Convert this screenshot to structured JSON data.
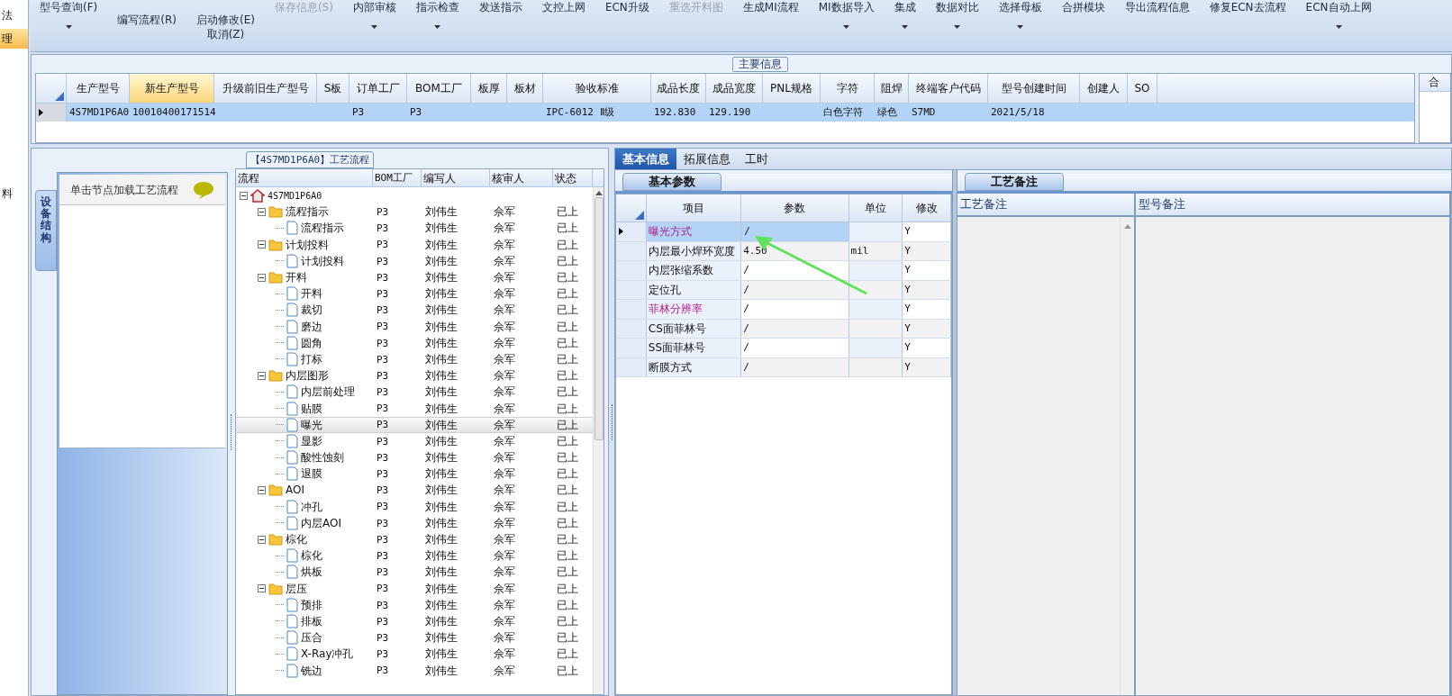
{
  "sidebar": {
    "items": [
      {
        "label": "法",
        "selected": false
      },
      {
        "label": "理",
        "selected": true
      },
      {
        "label": "料",
        "selected": false
      }
    ]
  },
  "toolbar": {
    "buttons": [
      {
        "kind": "top",
        "labels": [
          "型号查询(F)"
        ],
        "disabled": false,
        "dropdown": true
      },
      {
        "kind": "mid",
        "labels": [
          "编写流程(R)"
        ],
        "disabled": false,
        "dropdown": false
      },
      {
        "kind": "mid",
        "labels": [
          "启动修改(E)",
          "取消(Z)"
        ],
        "disabled": false,
        "dropdown": false
      },
      {
        "kind": "top",
        "labels": [
          "保存信息(S)"
        ],
        "disabled": true,
        "dropdown": false
      },
      {
        "kind": "top",
        "labels": [
          "内部审核"
        ],
        "disabled": false,
        "dropdown": true
      },
      {
        "kind": "top",
        "labels": [
          "指示检查"
        ],
        "disabled": false,
        "dropdown": true
      },
      {
        "kind": "top",
        "labels": [
          "发送指示"
        ],
        "disabled": false,
        "dropdown": false
      },
      {
        "kind": "top",
        "labels": [
          "文控上网"
        ],
        "disabled": false,
        "dropdown": false
      },
      {
        "kind": "top",
        "labels": [
          "ECN升级"
        ],
        "disabled": false,
        "dropdown": false
      },
      {
        "kind": "top",
        "labels": [
          "重选开料图"
        ],
        "disabled": true,
        "dropdown": false
      },
      {
        "kind": "top",
        "labels": [
          "生成MI流程"
        ],
        "disabled": false,
        "dropdown": false
      },
      {
        "kind": "top",
        "labels": [
          "MI数据导入"
        ],
        "disabled": false,
        "dropdown": true
      },
      {
        "kind": "top",
        "labels": [
          "集成"
        ],
        "disabled": false,
        "dropdown": true
      },
      {
        "kind": "top",
        "labels": [
          "数据对比"
        ],
        "disabled": false,
        "dropdown": true
      },
      {
        "kind": "top",
        "labels": [
          "选择母板"
        ],
        "disabled": false,
        "dropdown": true
      },
      {
        "kind": "top",
        "labels": [
          "合拼模块"
        ],
        "disabled": false,
        "dropdown": false
      },
      {
        "kind": "top",
        "labels": [
          "导出流程信息"
        ],
        "disabled": false,
        "dropdown": false
      },
      {
        "kind": "top",
        "labels": [
          "修复ECN去流程"
        ],
        "disabled": false,
        "dropdown": false
      },
      {
        "kind": "top",
        "labels": [
          "ECN自动上网"
        ],
        "disabled": false,
        "dropdown": true
      }
    ]
  },
  "main_info": {
    "title": "主要信息",
    "columns": [
      {
        "label": "生产型号",
        "selected": false
      },
      {
        "label": "新生产型号",
        "selected": true
      },
      {
        "label": "升级前旧生产型号",
        "selected": false
      },
      {
        "label": "S板",
        "selected": false
      },
      {
        "label": "订单工厂",
        "selected": false
      },
      {
        "label": "BOM工厂",
        "selected": false
      },
      {
        "label": "板厚",
        "selected": false
      },
      {
        "label": "板材",
        "selected": false
      },
      {
        "label": "验收标准",
        "selected": false
      },
      {
        "label": "成品长度",
        "selected": false
      },
      {
        "label": "成品宽度",
        "selected": false
      },
      {
        "label": "PNL规格",
        "selected": false
      },
      {
        "label": "字符",
        "selected": false
      },
      {
        "label": "阻焊",
        "selected": false
      },
      {
        "label": "终端客户代码",
        "selected": false
      },
      {
        "label": "型号创建时间",
        "selected": false
      },
      {
        "label": "创建人",
        "selected": false
      },
      {
        "label": "SO",
        "selected": false
      }
    ],
    "rows": [
      {
        "selected": true,
        "cells": [
          "4S7MD1P6A0",
          "10010400171514",
          "",
          "",
          "P3",
          "P3",
          "",
          "",
          "IPC-6012 Ⅱ级",
          "192.830",
          "129.190",
          "",
          "白色字符",
          "绿色",
          "S7MD",
          "2021/5/18",
          "",
          ""
        ]
      }
    ],
    "side_panel_header": "合"
  },
  "left_panel": {
    "tab": "设备结构",
    "hint": "单击节点加载工艺流程"
  },
  "process_flow": {
    "title": "【4S7MD1P6A0】工艺流程",
    "columns": [
      "流程",
      "BOM工厂",
      "编写人",
      "核审人",
      "状态"
    ],
    "tree": [
      {
        "label": "4S7MD1P6A0",
        "kind": "root",
        "expanded": true,
        "selected": false,
        "children": [
          {
            "label": "流程指示",
            "kind": "folder",
            "expanded": true,
            "selected": false,
            "values": [
              "P3",
              "刘伟生",
              "佘军",
              "已上"
            ],
            "children": [
              {
                "label": "流程指示",
                "kind": "step",
                "selected": false,
                "values": [
                  "P3",
                  "刘伟生",
                  "佘军",
                  "已上"
                ]
              }
            ]
          },
          {
            "label": "计划投料",
            "kind": "folder",
            "expanded": true,
            "selected": false,
            "values": [
              "P3",
              "刘伟生",
              "佘军",
              "已上"
            ],
            "children": [
              {
                "label": "计划投料",
                "kind": "step",
                "selected": false,
                "values": [
                  "P3",
                  "刘伟生",
                  "佘军",
                  "已上"
                ]
              }
            ]
          },
          {
            "label": "开料",
            "kind": "folder",
            "expanded": true,
            "selected": false,
            "values": [
              "P3",
              "刘伟生",
              "佘军",
              "已上"
            ],
            "children": [
              {
                "label": "开料",
                "kind": "step",
                "selected": false,
                "values": [
                  "P3",
                  "刘伟生",
                  "佘军",
                  "已上"
                ]
              },
              {
                "label": "裁切",
                "kind": "step",
                "selected": false,
                "values": [
                  "P3",
                  "刘伟生",
                  "佘军",
                  "已上"
                ]
              },
              {
                "label": "磨边",
                "kind": "step",
                "selected": false,
                "values": [
                  "P3",
                  "刘伟生",
                  "佘军",
                  "已上"
                ]
              },
              {
                "label": "圆角",
                "kind": "step",
                "selected": false,
                "values": [
                  "P3",
                  "刘伟生",
                  "佘军",
                  "已上"
                ]
              },
              {
                "label": "打标",
                "kind": "step",
                "selected": false,
                "values": [
                  "P3",
                  "刘伟生",
                  "佘军",
                  "已上"
                ]
              }
            ]
          },
          {
            "label": "内层图形",
            "kind": "folder",
            "expanded": true,
            "selected": false,
            "values": [
              "P3",
              "刘伟生",
              "佘军",
              "已上"
            ],
            "children": [
              {
                "label": "内层前处理",
                "kind": "step",
                "selected": false,
                "values": [
                  "P3",
                  "刘伟生",
                  "佘军",
                  "已上"
                ]
              },
              {
                "label": "贴膜",
                "kind": "step",
                "selected": false,
                "values": [
                  "P3",
                  "刘伟生",
                  "佘军",
                  "已上"
                ]
              },
              {
                "label": "曝光",
                "kind": "step",
                "selected": true,
                "values": [
                  "P3",
                  "刘伟生",
                  "佘军",
                  "已上"
                ]
              },
              {
                "label": "显影",
                "kind": "step",
                "selected": false,
                "values": [
                  "P3",
                  "刘伟生",
                  "佘军",
                  "已上"
                ]
              },
              {
                "label": "酸性蚀刻",
                "kind": "step",
                "selected": false,
                "values": [
                  "P3",
                  "刘伟生",
                  "佘军",
                  "已上"
                ]
              },
              {
                "label": "退膜",
                "kind": "step",
                "selected": false,
                "values": [
                  "P3",
                  "刘伟生",
                  "佘军",
                  "已上"
                ]
              }
            ]
          },
          {
            "label": "AOI",
            "kind": "folder",
            "expanded": true,
            "selected": false,
            "values": [
              "P3",
              "刘伟生",
              "佘军",
              "已上"
            ],
            "children": [
              {
                "label": "冲孔",
                "kind": "step",
                "selected": false,
                "values": [
                  "P3",
                  "刘伟生",
                  "佘军",
                  "已上"
                ]
              },
              {
                "label": "内层AOI",
                "kind": "step",
                "selected": false,
                "values": [
                  "P3",
                  "刘伟生",
                  "佘军",
                  "已上"
                ]
              }
            ]
          },
          {
            "label": "棕化",
            "kind": "folder",
            "expanded": true,
            "selected": false,
            "values": [
              "P3",
              "刘伟生",
              "佘军",
              "已上"
            ],
            "children": [
              {
                "label": "棕化",
                "kind": "step",
                "selected": false,
                "values": [
                  "P3",
                  "刘伟生",
                  "佘军",
                  "已上"
                ]
              },
              {
                "label": "烘板",
                "kind": "step",
                "selected": false,
                "values": [
                  "P3",
                  "刘伟生",
                  "佘军",
                  "已上"
                ]
              }
            ]
          },
          {
            "label": "层压",
            "kind": "folder",
            "expanded": true,
            "selected": false,
            "values": [
              "P3",
              "刘伟生",
              "佘军",
              "已上"
            ],
            "children": [
              {
                "label": "预排",
                "kind": "step",
                "selected": false,
                "values": [
                  "P3",
                  "刘伟生",
                  "佘军",
                  "已上"
                ]
              },
              {
                "label": "排板",
                "kind": "step",
                "selected": false,
                "values": [
                  "P3",
                  "刘伟生",
                  "佘军",
                  "已上"
                ]
              },
              {
                "label": "压合",
                "kind": "step",
                "selected": false,
                "values": [
                  "P3",
                  "刘伟生",
                  "佘军",
                  "已上"
                ]
              },
              {
                "label": "X-Ray冲孔",
                "kind": "step",
                "selected": false,
                "values": [
                  "P3",
                  "刘伟生",
                  "佘军",
                  "已上"
                ]
              },
              {
                "label": "铣边",
                "kind": "step",
                "selected": false,
                "values": [
                  "P3",
                  "刘伟生",
                  "佘军",
                  "已上"
                ]
              }
            ]
          }
        ]
      }
    ]
  },
  "detail_tabs": [
    {
      "label": "基本信息",
      "selected": true
    },
    {
      "label": "拓展信息",
      "selected": false
    },
    {
      "label": "工时",
      "selected": false
    }
  ],
  "basic_params": {
    "tab": "基本参数",
    "columns": [
      "项目",
      "参数",
      "单位",
      "修改"
    ],
    "rows": [
      {
        "item": "曝光方式",
        "value": "/",
        "unit": "",
        "modify": "Y",
        "emphasized": true,
        "selected": true
      },
      {
        "item": "内层最小焊环宽度",
        "value": "4.50",
        "unit": "mil",
        "modify": "Y",
        "emphasized": false,
        "selected": false
      },
      {
        "item": "内层张缩系数",
        "value": "/",
        "unit": "",
        "modify": "Y",
        "emphasized": false,
        "selected": false
      },
      {
        "item": "定位孔",
        "value": "/",
        "unit": "",
        "modify": "Y",
        "emphasized": false,
        "selected": false
      },
      {
        "item": "菲林分辨率",
        "value": "/",
        "unit": "",
        "modify": "Y",
        "emphasized": true,
        "selected": false
      },
      {
        "item": "CS面菲林号",
        "value": "/",
        "unit": "",
        "modify": "Y",
        "emphasized": false,
        "selected": false
      },
      {
        "item": "SS面菲林号",
        "value": "/",
        "unit": "",
        "modify": "Y",
        "emphasized": false,
        "selected": false
      },
      {
        "item": "断膜方式",
        "value": "/",
        "unit": "",
        "modify": "Y",
        "emphasized": false,
        "selected": false
      }
    ]
  },
  "process_notes": {
    "tab": "工艺备注",
    "columns": [
      "工艺备注",
      "型号备注"
    ]
  }
}
